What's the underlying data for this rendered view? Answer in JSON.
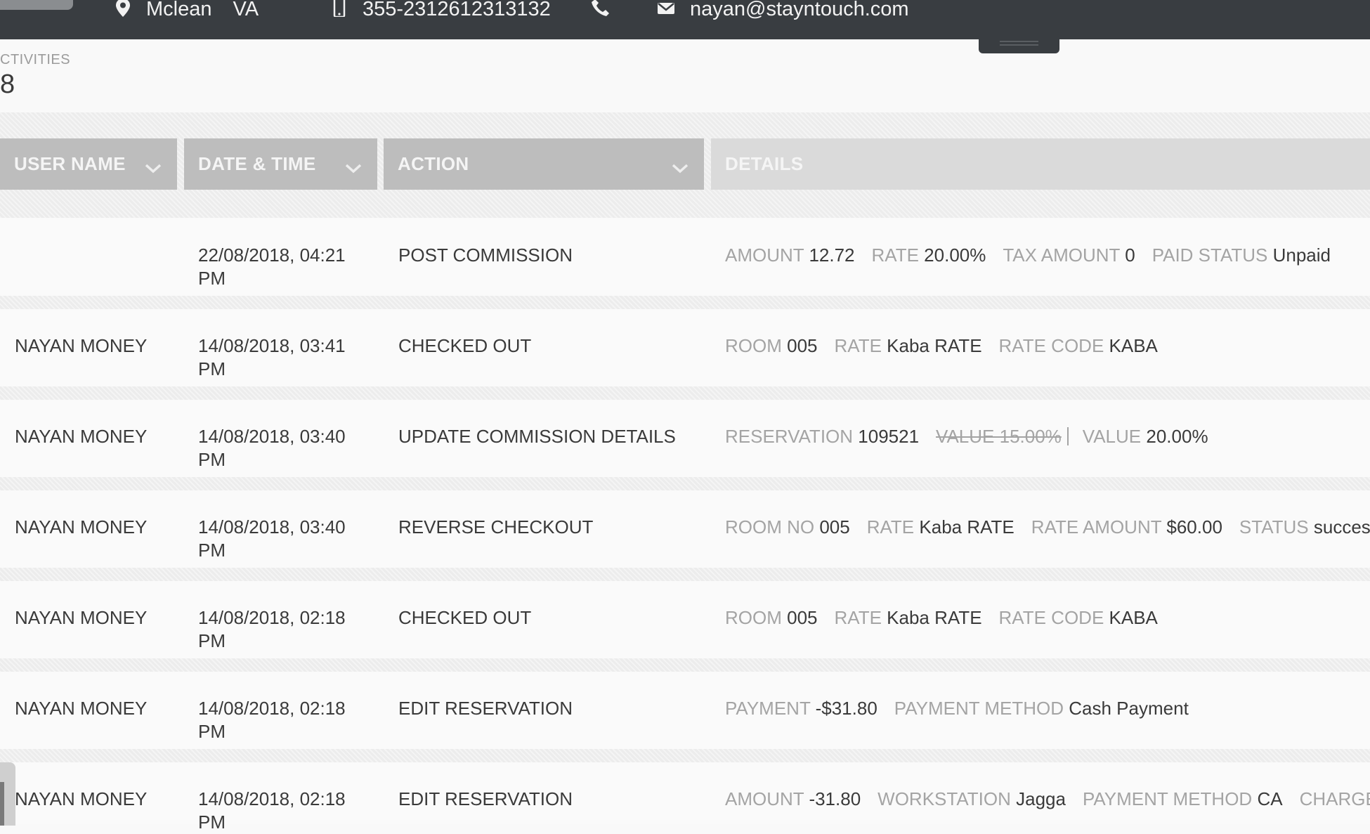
{
  "header": {
    "city": "Mclean",
    "state": "VA",
    "phone": "355-2312612313132",
    "email": "nayan@stayntouch.com"
  },
  "summary": {
    "label": "CTIVITIES",
    "count": "8"
  },
  "table": {
    "columns": [
      "USER NAME",
      "DATE & TIME",
      "ACTION",
      "DETAILS"
    ],
    "rows": [
      {
        "user": "",
        "date_line1": "22/08/2018, 04:21",
        "date_line2": "PM",
        "action": "POST COMMISSION",
        "details": [
          {
            "label": "AMOUNT",
            "value": "12.72"
          },
          {
            "label": "RATE",
            "value": "20.00%"
          },
          {
            "label": "TAX AMOUNT",
            "value": "0"
          },
          {
            "label": "PAID STATUS",
            "value": "Unpaid"
          }
        ]
      },
      {
        "user": "NAYAN MONEY",
        "date_line1": "14/08/2018, 03:41",
        "date_line2": "PM",
        "action": "CHECKED OUT",
        "details": [
          {
            "label": "ROOM",
            "value": "005"
          },
          {
            "label": "RATE",
            "value": "Kaba RATE"
          },
          {
            "label": "RATE CODE",
            "value": "KABA"
          }
        ]
      },
      {
        "user": "NAYAN MONEY",
        "date_line1": "14/08/2018, 03:40",
        "date_line2": "PM",
        "action": "UPDATE COMMISSION DETAILS",
        "details": [
          {
            "label": "RESERVATION",
            "value": "109521"
          }
        ],
        "old_value": "VALUE 15.00%",
        "new_value": {
          "label": "VALUE",
          "value": "20.00%"
        }
      },
      {
        "user": "NAYAN MONEY",
        "date_line1": "14/08/2018, 03:40",
        "date_line2": "PM",
        "action": "REVERSE CHECKOUT",
        "details": [
          {
            "label": "ROOM NO",
            "value": "005"
          },
          {
            "label": "RATE",
            "value": "Kaba RATE"
          },
          {
            "label": "RATE AMOUNT",
            "value": "$60.00"
          },
          {
            "label": "STATUS",
            "value": "success"
          }
        ]
      },
      {
        "user": "NAYAN MONEY",
        "date_line1": "14/08/2018, 02:18",
        "date_line2": "PM",
        "action": "CHECKED OUT",
        "details": [
          {
            "label": "ROOM",
            "value": "005"
          },
          {
            "label": "RATE",
            "value": "Kaba RATE"
          },
          {
            "label": "RATE CODE",
            "value": "KABA"
          }
        ]
      },
      {
        "user": "NAYAN MONEY",
        "date_line1": "14/08/2018, 02:18",
        "date_line2": "PM",
        "action": "EDIT RESERVATION",
        "details": [
          {
            "label": "PAYMENT",
            "value": "-$31.80"
          },
          {
            "label": "PAYMENT METHOD",
            "value": "Cash Payment"
          }
        ]
      },
      {
        "user": "NAYAN MONEY",
        "date_line1": "14/08/2018, 02:18",
        "date_line2": "PM",
        "action": "EDIT RESERVATION",
        "details": [
          {
            "label": "AMOUNT",
            "value": "-31.80"
          },
          {
            "label": "WORKSTATION",
            "value": "Jagga"
          },
          {
            "label": "PAYMENT METHOD",
            "value": "CA"
          },
          {
            "label": "CHARGE CO",
            "value": ""
          }
        ]
      }
    ]
  },
  "icons": {
    "location": "location-pin-icon",
    "phone": "mobile-phone-icon",
    "call": "call-icon",
    "email": "envelope-icon",
    "sort": "chevron-down-icon"
  },
  "colors": {
    "topbar": "#393d41",
    "header_cell": "#bdbdbd",
    "details_header": "#dadada",
    "label_gray": "#a4a4a4"
  }
}
